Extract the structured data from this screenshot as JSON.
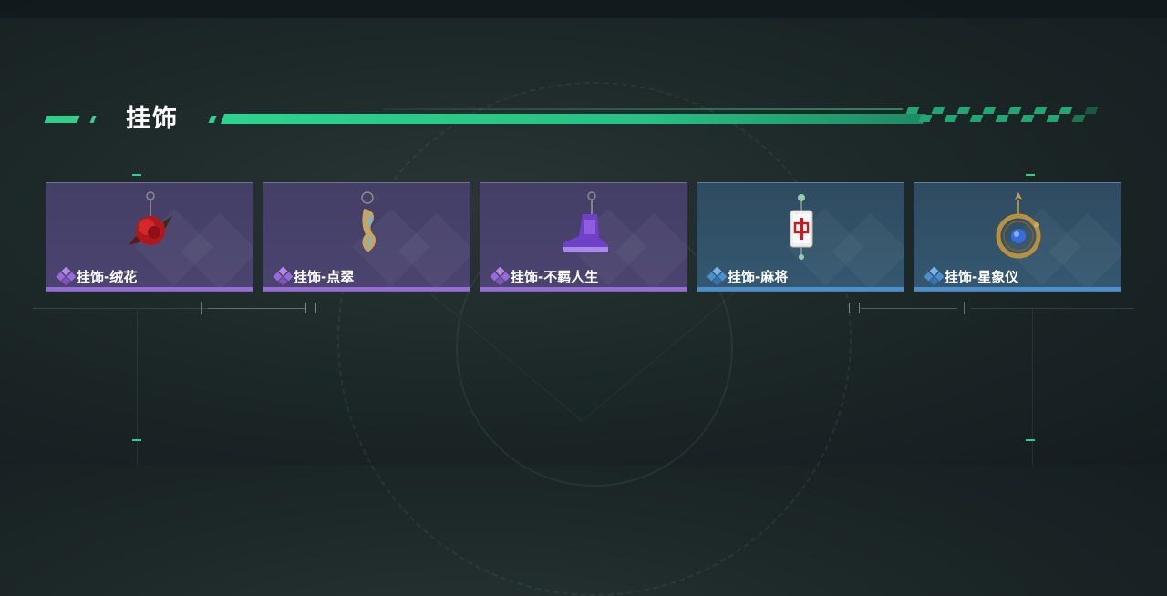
{
  "section": {
    "title": "挂饰"
  },
  "cards": [
    {
      "label": "挂饰-绒花",
      "rarity": "purple",
      "icon": "rose-charm-icon"
    },
    {
      "label": "挂饰-点翠",
      "rarity": "purple",
      "icon": "phoenix-charm-icon"
    },
    {
      "label": "挂饰-不羁人生",
      "rarity": "purple",
      "icon": "sneaker-charm-icon"
    },
    {
      "label": "挂饰-麻将",
      "rarity": "blue",
      "icon": "mahjong-charm-icon"
    },
    {
      "label": "挂饰-星象仪",
      "rarity": "blue",
      "icon": "astrolabe-charm-icon"
    }
  ],
  "rarity_colors": {
    "purple": "#9a6bd8",
    "blue": "#4a8fd0"
  },
  "accent_color": "#2fd08c"
}
